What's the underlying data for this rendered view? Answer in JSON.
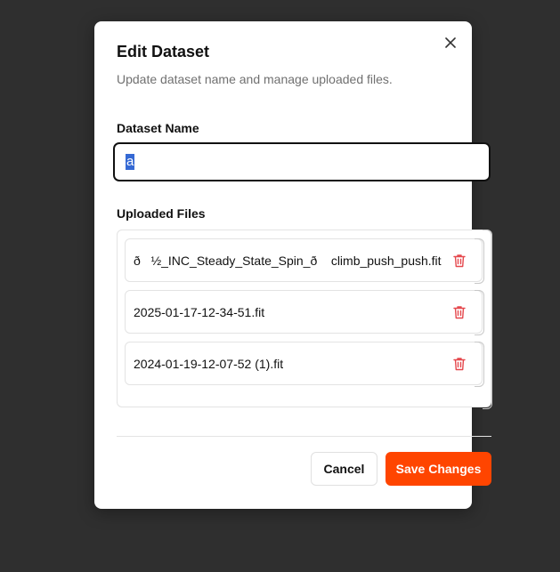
{
  "dialog": {
    "title": "Edit Dataset",
    "subtitle": "Update dataset name and manage uploaded files.",
    "close_icon": "close-icon"
  },
  "dataset_name": {
    "label": "Dataset Name",
    "value": "a",
    "value_selected": true
  },
  "uploaded_files": {
    "label": "Uploaded Files",
    "files": [
      {
        "name": "ð   ½_INC_Steady_State_Spin_ð    climb_push_push.fit",
        "icon": "trash-icon"
      },
      {
        "name": "2025-01-17-12-34-51.fit",
        "icon": "trash-icon"
      },
      {
        "name": "2024-01-19-12-07-52 (1).fit",
        "icon": "trash-icon"
      }
    ]
  },
  "actions": {
    "cancel_label": "Cancel",
    "save_label": "Save Changes"
  },
  "colors": {
    "backdrop": "#2f2f2f",
    "accent": "#ff4500",
    "delete": "#e5484d",
    "selection": "#3569d4"
  }
}
